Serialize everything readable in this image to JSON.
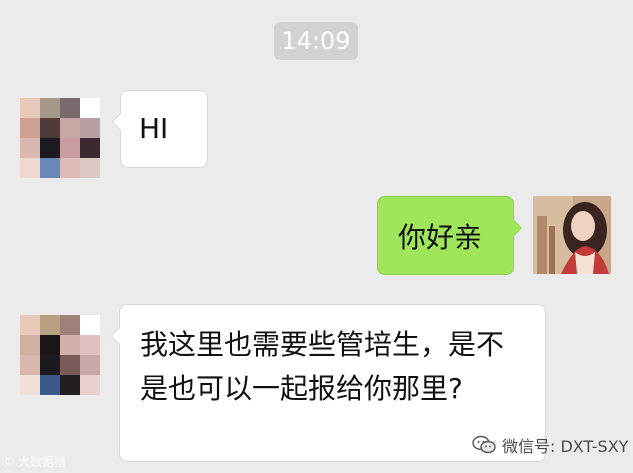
{
  "timestamp": "14:09",
  "messages": [
    {
      "side": "left",
      "text": "HI"
    },
    {
      "side": "right",
      "text": "你好亲"
    },
    {
      "side": "left",
      "text": "我这里也需要些管培生，是不是也可以一起报给你那里?"
    }
  ],
  "avatars": {
    "contact_1_pixels": [
      "#e8c8b8",
      "#a69888",
      "#7a6a6c",
      "#ffffff",
      "#cca092",
      "#4e3a38",
      "#c8a8a4",
      "#b8a0a2",
      "#d8b8b0",
      "#1e1a22",
      "#c89ca0",
      "#3c2a32",
      "#eed8d0",
      "#6888b8",
      "#e0b8b8",
      "#dcc8c4"
    ],
    "contact_2_pixels": [
      "#e8c8b8",
      "#b8a080",
      "#a08078",
      "#ffffff",
      "#d0b0a0",
      "#1a1618",
      "#d4b0aa",
      "#e0c0c0",
      "#d8b8ac",
      "#1c1a1e",
      "#7a5a58",
      "#c8a8a8",
      "#f0e0d8",
      "#3a5a8c",
      "#221e22",
      "#e8d0cc"
    ],
    "me_description": "profile-photo"
  },
  "watermarks": {
    "bottom_left": "大数据猎",
    "bottom_left_prefix": "Ⓒ",
    "right": "微信号: DXT-SXY"
  },
  "colors": {
    "background": "#ebebeb",
    "bubble_left": "#ffffff",
    "bubble_right": "#9fe65a",
    "timestamp_bg": "#d2d2d2"
  }
}
